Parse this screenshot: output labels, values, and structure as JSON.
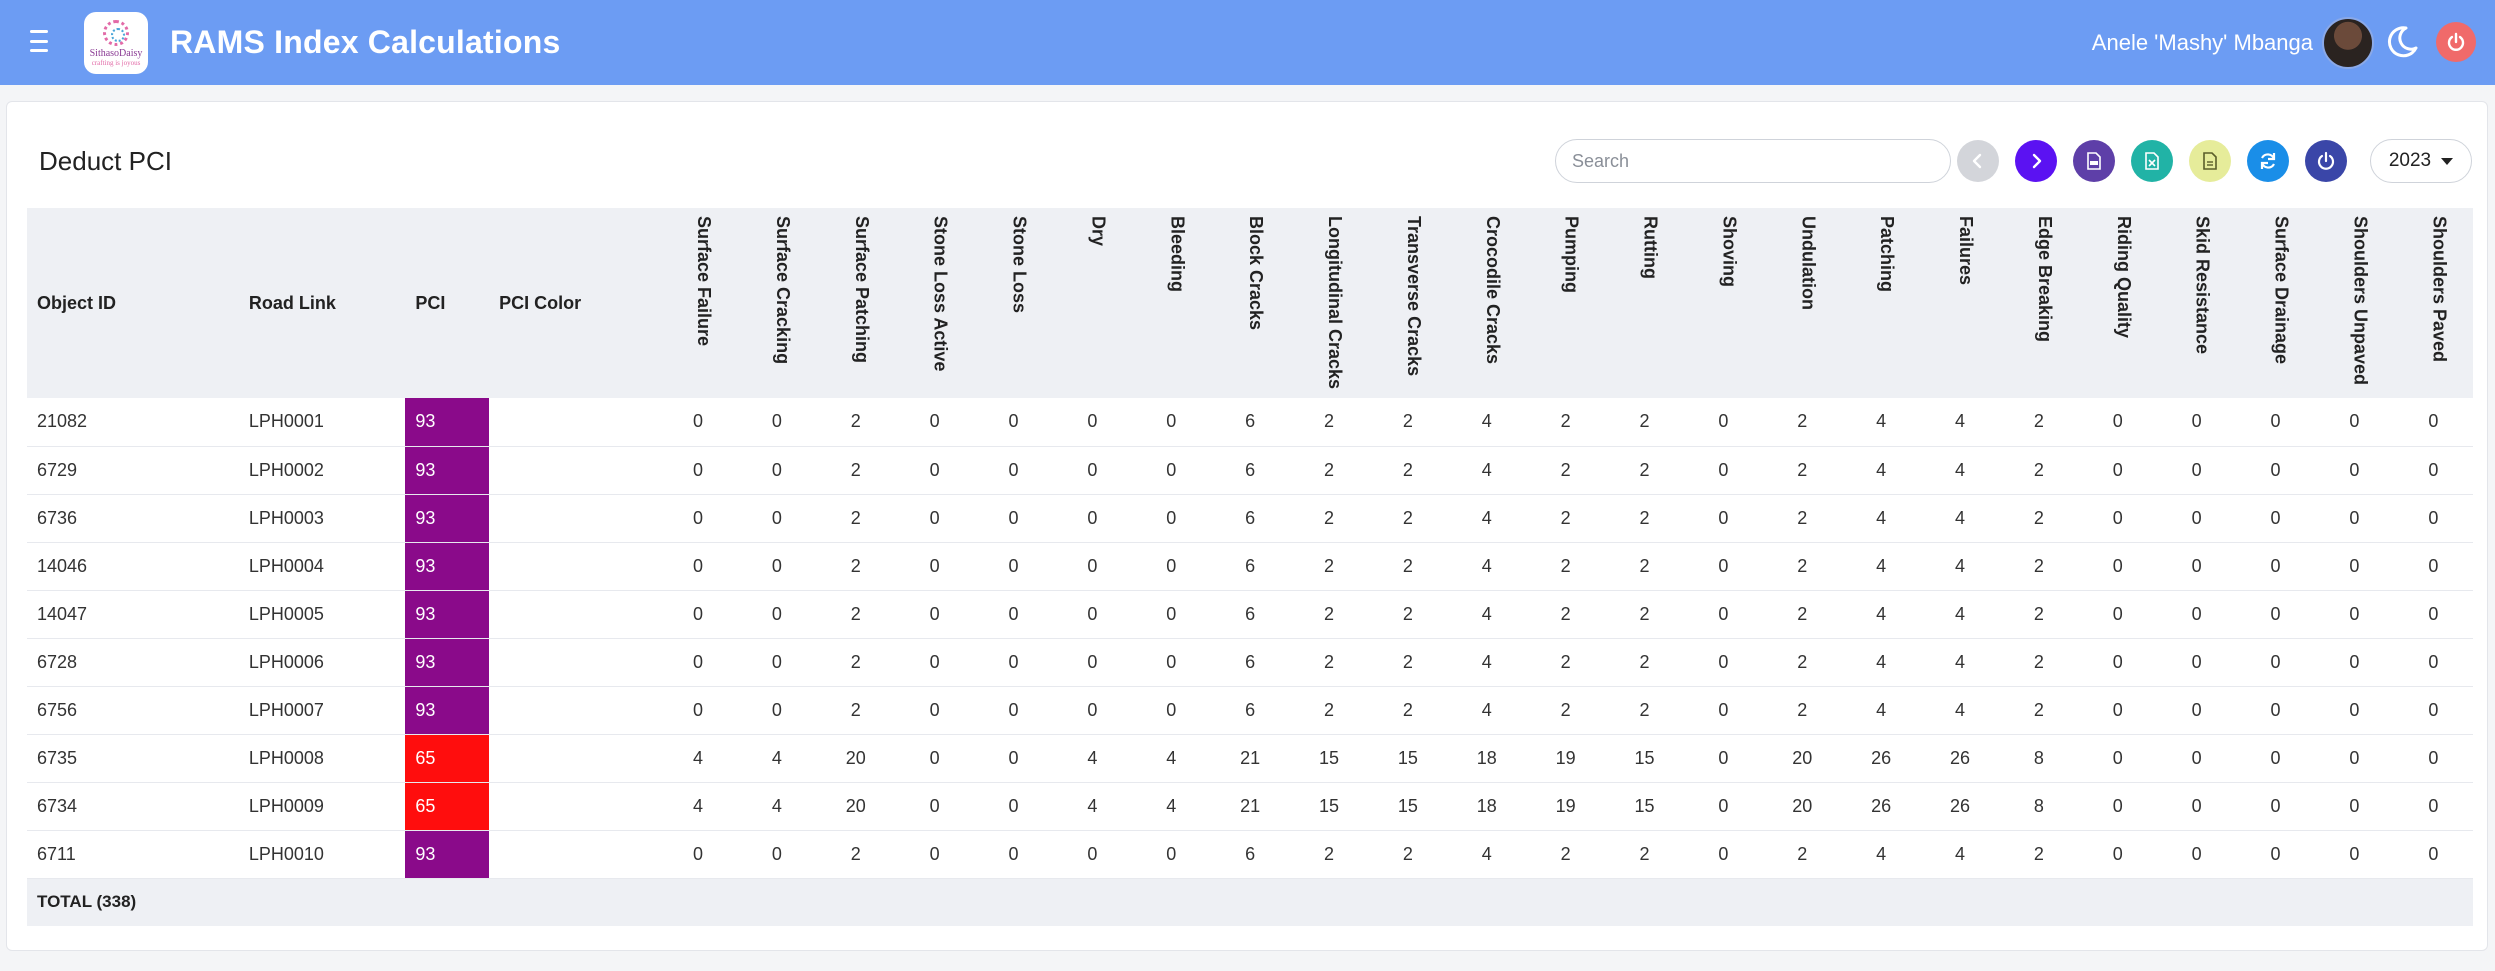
{
  "header": {
    "title": "RAMS Index Calculations",
    "user_name": "Anele 'Mashy' Mbanga",
    "logo": {
      "brand": "SithasoDaisy",
      "tagline": "crafting is joyous"
    }
  },
  "card": {
    "title": "Deduct PCI"
  },
  "toolbar": {
    "search_placeholder": "Search",
    "year": "2023",
    "buttons": [
      {
        "name": "prev-page-button",
        "icon": "chevron-left-icon",
        "color": "#d3d5da",
        "glyph": "#ffffff"
      },
      {
        "name": "next-page-button",
        "icon": "chevron-right-icon",
        "color": "#5b12f2",
        "glyph": "#ffffff"
      },
      {
        "name": "export-pdf-button",
        "icon": "pdf-icon",
        "color": "#5e3fa8",
        "glyph": "#ffffff"
      },
      {
        "name": "export-excel-button",
        "icon": "excel-icon",
        "color": "#21b3a6",
        "glyph": "#ffffff"
      },
      {
        "name": "export-csv-button",
        "icon": "csv-icon",
        "color": "#e6ec9a",
        "glyph": "#5b5e2a"
      },
      {
        "name": "refresh-button",
        "icon": "refresh-icon",
        "color": "#1a8ee8",
        "glyph": "#ffffff"
      },
      {
        "name": "power-button",
        "icon": "power-icon",
        "color": "#3a46a8",
        "glyph": "#ffffff"
      }
    ]
  },
  "colors": {
    "pci_93": "#8a0a8a",
    "pci_65": "#ff0d0d",
    "topbar": "#6c9cf3"
  },
  "table": {
    "fixed_columns": [
      "Object ID",
      "Road Link",
      "PCI",
      "PCI Color"
    ],
    "distress_columns": [
      "Surface Failure",
      "Surface Cracking",
      "Surface Patching",
      "Stone Loss Active",
      "Stone Loss",
      "Dry",
      "Bleeding",
      "Block Cracks",
      "Longitudinal Cracks",
      "Transverse Cracks",
      "Crocodile Cracks",
      "Pumping",
      "Rutting",
      "Shoving",
      "Undulation",
      "Patching",
      "Failures",
      "Edge Breaking",
      "Riding Quality",
      "Skid Resistance",
      "Surface Drainage",
      "Shoulders Unpaved",
      "Shoulders Paved"
    ],
    "rows": [
      {
        "object_id": "21082",
        "road_link": "LPH0001",
        "pci": "93",
        "pci_color": "#8a0a8a",
        "values": [
          "0",
          "0",
          "2",
          "0",
          "0",
          "0",
          "0",
          "6",
          "2",
          "2",
          "4",
          "2",
          "2",
          "0",
          "2",
          "4",
          "4",
          "2",
          "0",
          "0",
          "0",
          "0",
          "0"
        ]
      },
      {
        "object_id": "6729",
        "road_link": "LPH0002",
        "pci": "93",
        "pci_color": "#8a0a8a",
        "values": [
          "0",
          "0",
          "2",
          "0",
          "0",
          "0",
          "0",
          "6",
          "2",
          "2",
          "4",
          "2",
          "2",
          "0",
          "2",
          "4",
          "4",
          "2",
          "0",
          "0",
          "0",
          "0",
          "0"
        ]
      },
      {
        "object_id": "6736",
        "road_link": "LPH0003",
        "pci": "93",
        "pci_color": "#8a0a8a",
        "values": [
          "0",
          "0",
          "2",
          "0",
          "0",
          "0",
          "0",
          "6",
          "2",
          "2",
          "4",
          "2",
          "2",
          "0",
          "2",
          "4",
          "4",
          "2",
          "0",
          "0",
          "0",
          "0",
          "0"
        ]
      },
      {
        "object_id": "14046",
        "road_link": "LPH0004",
        "pci": "93",
        "pci_color": "#8a0a8a",
        "values": [
          "0",
          "0",
          "2",
          "0",
          "0",
          "0",
          "0",
          "6",
          "2",
          "2",
          "4",
          "2",
          "2",
          "0",
          "2",
          "4",
          "4",
          "2",
          "0",
          "0",
          "0",
          "0",
          "0"
        ]
      },
      {
        "object_id": "14047",
        "road_link": "LPH0005",
        "pci": "93",
        "pci_color": "#8a0a8a",
        "values": [
          "0",
          "0",
          "2",
          "0",
          "0",
          "0",
          "0",
          "6",
          "2",
          "2",
          "4",
          "2",
          "2",
          "0",
          "2",
          "4",
          "4",
          "2",
          "0",
          "0",
          "0",
          "0",
          "0"
        ]
      },
      {
        "object_id": "6728",
        "road_link": "LPH0006",
        "pci": "93",
        "pci_color": "#8a0a8a",
        "values": [
          "0",
          "0",
          "2",
          "0",
          "0",
          "0",
          "0",
          "6",
          "2",
          "2",
          "4",
          "2",
          "2",
          "0",
          "2",
          "4",
          "4",
          "2",
          "0",
          "0",
          "0",
          "0",
          "0"
        ]
      },
      {
        "object_id": "6756",
        "road_link": "LPH0007",
        "pci": "93",
        "pci_color": "#8a0a8a",
        "values": [
          "0",
          "0",
          "2",
          "0",
          "0",
          "0",
          "0",
          "6",
          "2",
          "2",
          "4",
          "2",
          "2",
          "0",
          "2",
          "4",
          "4",
          "2",
          "0",
          "0",
          "0",
          "0",
          "0"
        ]
      },
      {
        "object_id": "6735",
        "road_link": "LPH0008",
        "pci": "65",
        "pci_color": "#ff0d0d",
        "values": [
          "4",
          "4",
          "20",
          "0",
          "0",
          "4",
          "4",
          "21",
          "15",
          "15",
          "18",
          "19",
          "15",
          "0",
          "20",
          "26",
          "26",
          "8",
          "0",
          "0",
          "0",
          "0",
          "0"
        ]
      },
      {
        "object_id": "6734",
        "road_link": "LPH0009",
        "pci": "65",
        "pci_color": "#ff0d0d",
        "values": [
          "4",
          "4",
          "20",
          "0",
          "0",
          "4",
          "4",
          "21",
          "15",
          "15",
          "18",
          "19",
          "15",
          "0",
          "20",
          "26",
          "26",
          "8",
          "0",
          "0",
          "0",
          "0",
          "0"
        ]
      },
      {
        "object_id": "6711",
        "road_link": "LPH0010",
        "pci": "93",
        "pci_color": "#8a0a8a",
        "values": [
          "0",
          "0",
          "2",
          "0",
          "0",
          "0",
          "0",
          "6",
          "2",
          "2",
          "4",
          "2",
          "2",
          "0",
          "2",
          "4",
          "4",
          "2",
          "0",
          "0",
          "0",
          "0",
          "0"
        ]
      }
    ],
    "footer": {
      "total_label": "TOTAL (338)"
    }
  }
}
